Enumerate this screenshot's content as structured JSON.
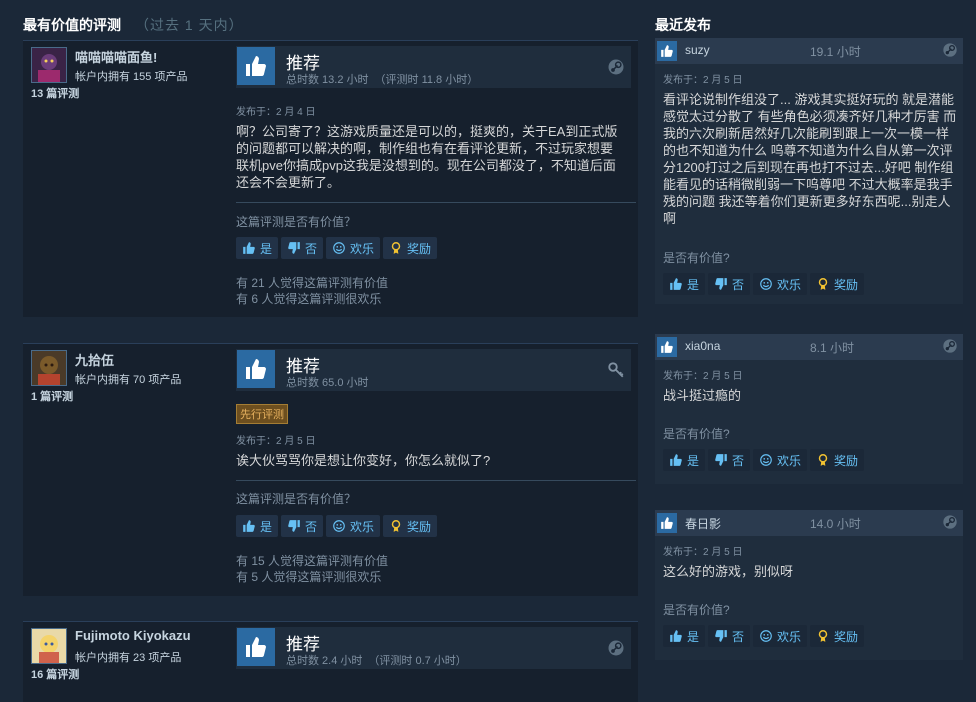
{
  "left_section": {
    "title": "最有价值的评测",
    "period": "（过去 1 天内）"
  },
  "right_section": {
    "title": "最近发布"
  },
  "reviews": [
    {
      "author": "喵喵喵喵面鱼!",
      "owned": "帐户内拥有 155 项产品",
      "review_count": "13 篇评测",
      "recommend": "推荐",
      "hours": "总时数 13.2 小时",
      "hours_at_review": "（评测时 11.8 小时）",
      "posted": "发布于：2 月 4 日",
      "text": "啊？公司寄了？这游戏质量还是可以的，挺爽的，关于EA到正式版的问题都可以解决的啊，制作组也有在看评论更新，不过玩家想要联机pve你搞成pvp这我是没想到的。现在公司都没了，不知道后面还会不会更新了。",
      "helpful_q": "这篇评测是否有价值？",
      "btn_yes": "是",
      "btn_no": "否",
      "btn_funny": "欢乐",
      "btn_award": "奖励",
      "stat_helpful": "有 21 人觉得这篇评测有价值",
      "stat_funny": "有 6 人觉得这篇评测很欢乐"
    },
    {
      "author": "九拾伍",
      "owned": "帐户内拥有 70 项产品",
      "review_count": "1 篇评测",
      "recommend": "推荐",
      "hours": "总时数 65.0 小时",
      "hours_at_review": "",
      "badge": "先行评测",
      "posted": "发布于：2 月 5 日",
      "text": "诶大伙骂骂你是想让你变好，你怎么就似了?",
      "helpful_q": "这篇评测是否有价值？",
      "btn_yes": "是",
      "btn_no": "否",
      "btn_funny": "欢乐",
      "btn_award": "奖励",
      "stat_helpful": "有 15 人觉得这篇评测有价值",
      "stat_funny": "有 5 人觉得这篇评测很欢乐"
    },
    {
      "author": "Fujimoto Kiyokazu",
      "owned": "帐户内拥有 23 项产品",
      "review_count": "16 篇评测",
      "recommend": "推荐",
      "hours": "总时数 2.4 小时",
      "hours_at_review": "（评测时 0.7 小时）"
    }
  ],
  "recent": [
    {
      "user": "suzy",
      "hours": "19.1 小时",
      "posted": "发布于：2 月 5 日",
      "text": "看评论说制作组没了... 游戏其实挺好玩的 就是潜能感觉太过分散了 有些角色必须凑齐好几种才厉害 而我的六次刷新居然好几次能刷到跟上一次一模一样的也不知道为什么 呜尊不知道为什么自从第一次评分1200打过之后到现在再也打不过去...好吧 制作组能看见的话稍微削弱一下呜尊吧 不过大概率是我手残的问题 我还等着你们更新更多好东西呢...别走人啊",
      "helpful_q": "是否有价值?",
      "btn_yes": "是",
      "btn_no": "否",
      "btn_funny": "欢乐",
      "btn_award": "奖励"
    },
    {
      "user": "xia0na",
      "hours": "8.1 小时",
      "posted": "发布于：2 月 5 日",
      "text": "战斗挺过瘾的",
      "helpful_q": "是否有价值?",
      "btn_yes": "是",
      "btn_no": "否",
      "btn_funny": "欢乐",
      "btn_award": "奖励"
    },
    {
      "user": "春日影",
      "hours": "14.0 小时",
      "posted": "发布于：2 月 5 日",
      "text": "这么好的游戏，别似呀",
      "helpful_q": "是否有价值?",
      "btn_yes": "是",
      "btn_no": "否",
      "btn_funny": "欢乐",
      "btn_award": "奖励"
    }
  ],
  "colors": {
    "page_bg": "#1b2838",
    "panel_bg": "#16202d",
    "accent": "#66c0f4",
    "thumb_blue": "#2b6aa2",
    "ea_badge": "#6d4f1f"
  },
  "icons": [
    "thumbs-up-icon",
    "thumbs-down-icon",
    "smiley-icon",
    "award-icon",
    "steam-icon",
    "key-icon"
  ]
}
